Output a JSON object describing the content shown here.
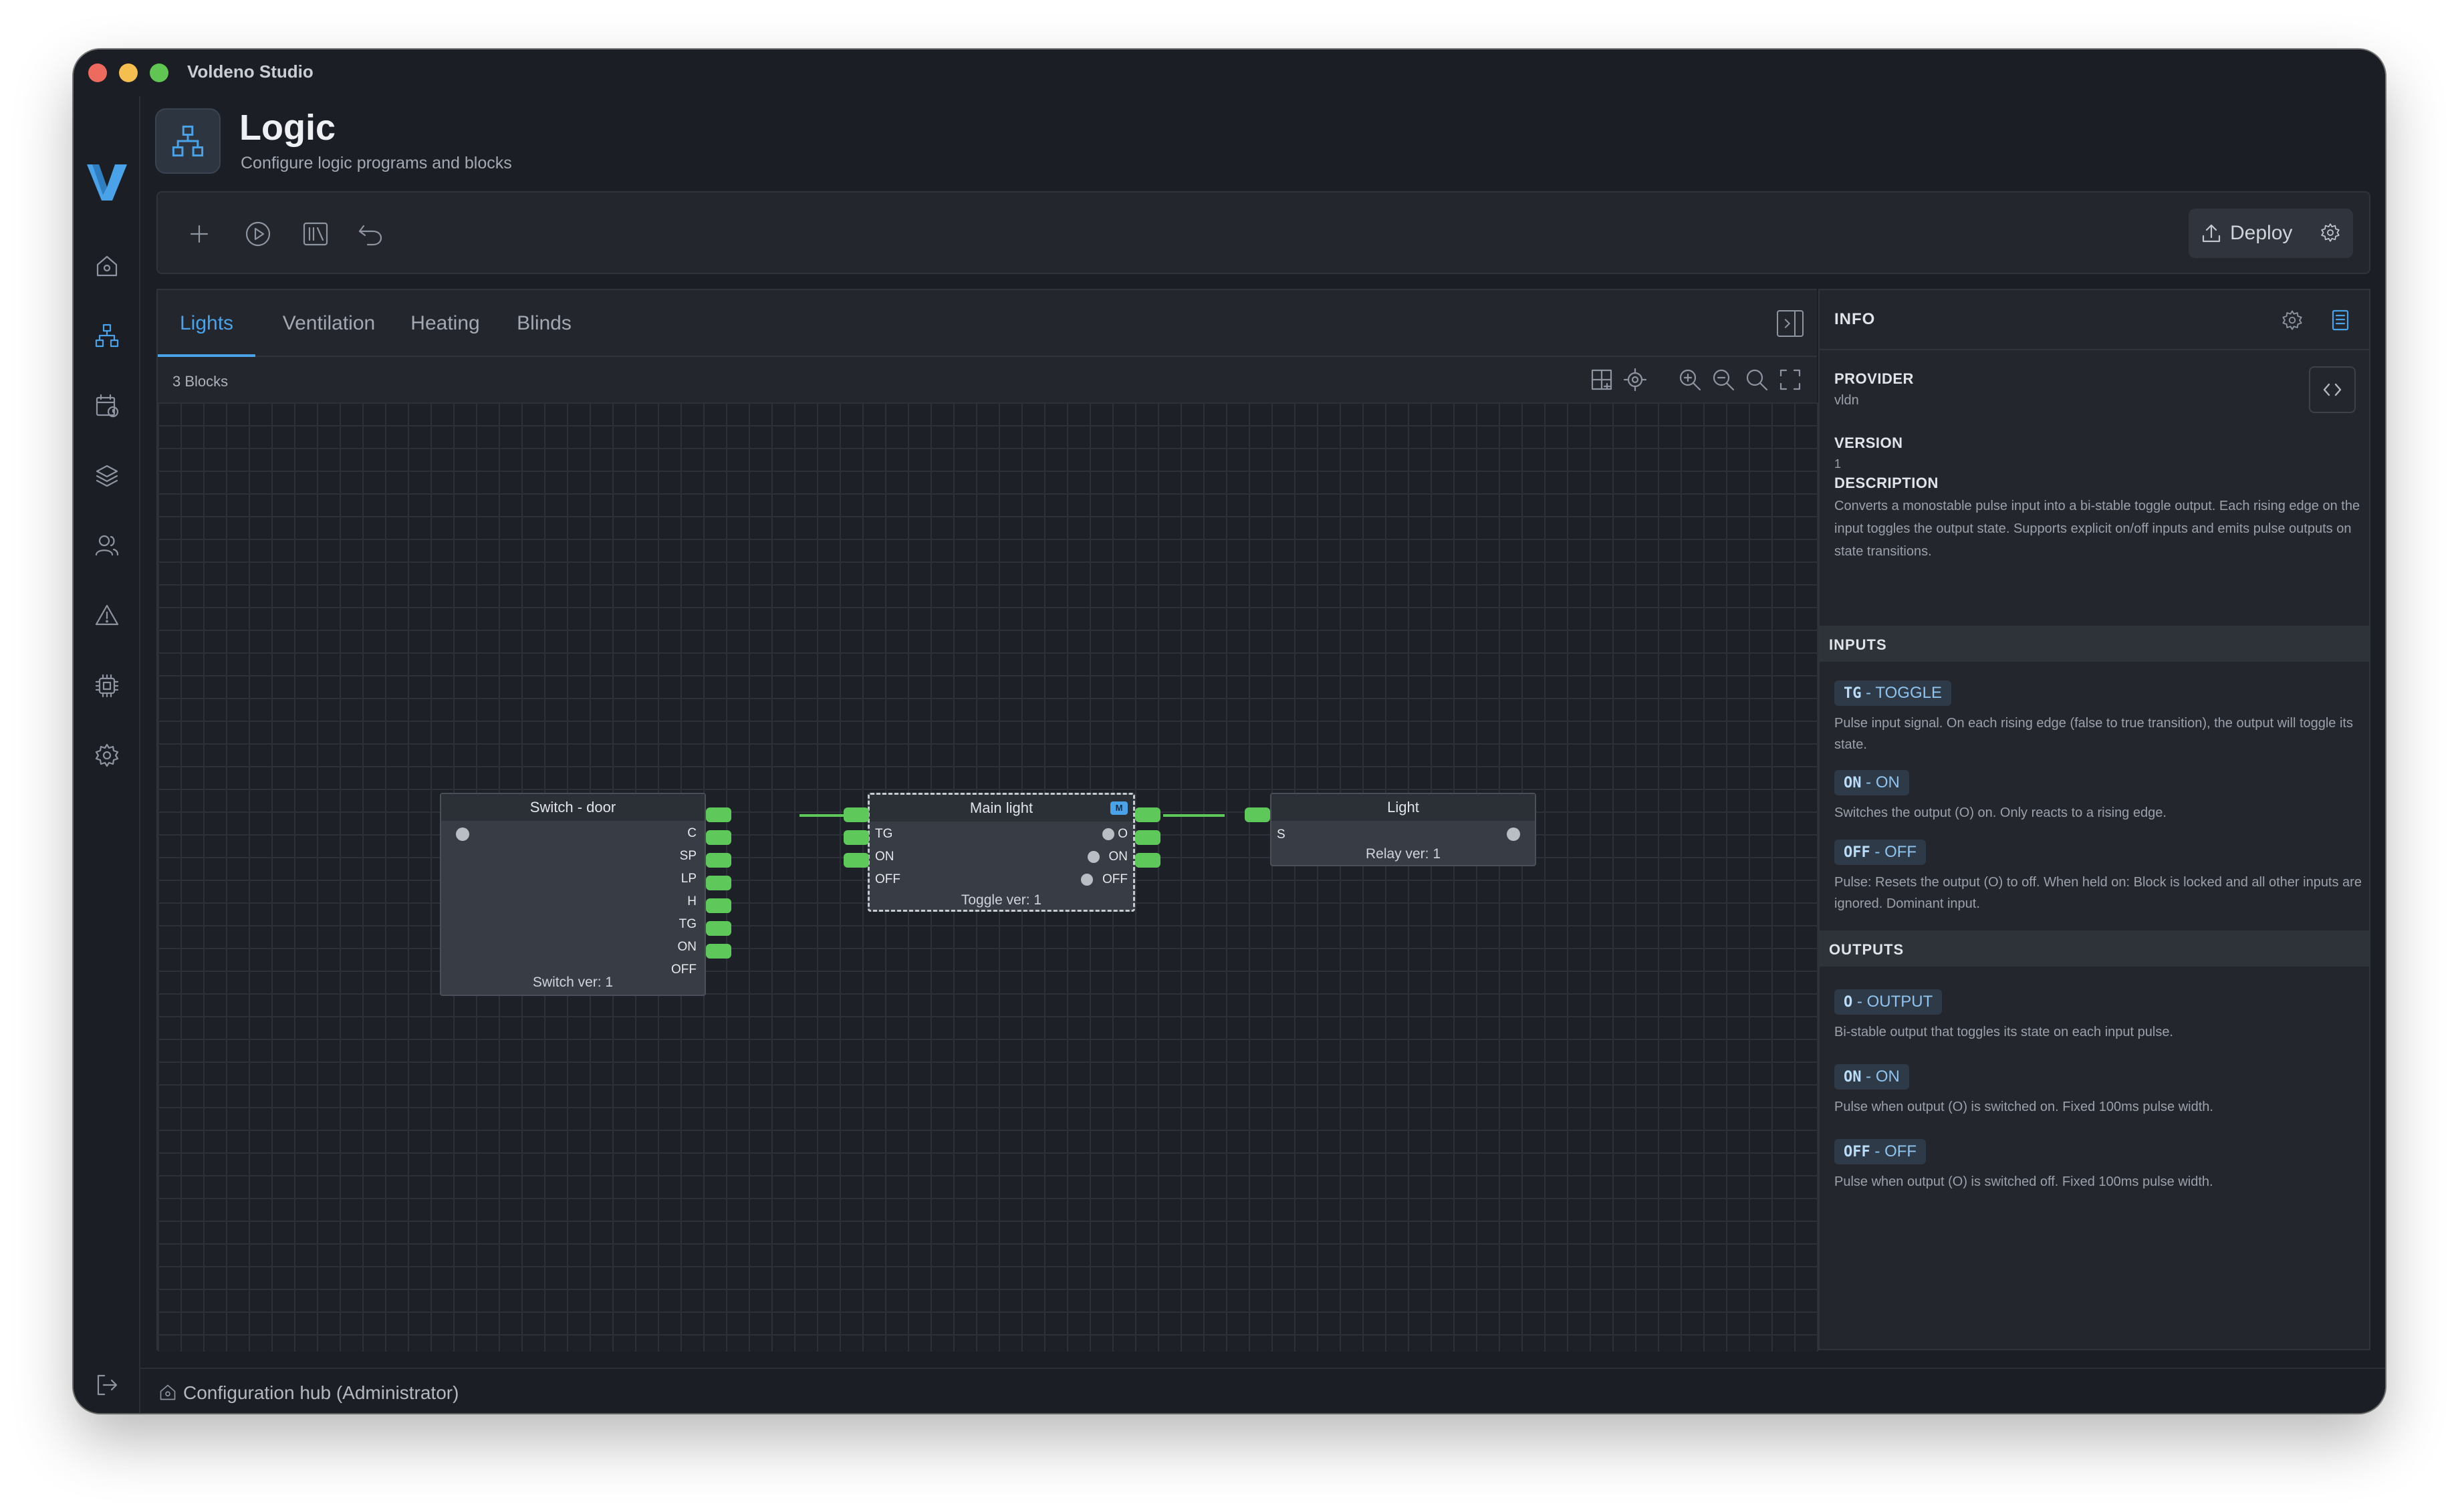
{
  "app": {
    "title": "Voldeno Studio"
  },
  "header": {
    "title": "Logic",
    "subtitle": "Configure logic programs and blocks"
  },
  "nav": [
    "home-icon",
    "logic-icon",
    "schedule-icon",
    "layers-icon",
    "users-icon",
    "alerts-icon",
    "hardware-icon",
    "settings-icon",
    "logout-icon"
  ],
  "toolbar": {
    "deploy_label": "Deploy"
  },
  "tabs": [
    "Lights",
    "Ventilation",
    "Heating",
    "Blinds"
  ],
  "canvas": {
    "blocks_count": "3 Blocks"
  },
  "blocks": {
    "switch": {
      "title": "Switch - door",
      "footer": "Switch ver: 1",
      "outputs": [
        "C",
        "SP",
        "LP",
        "H",
        "TG",
        "ON",
        "OFF"
      ]
    },
    "toggle": {
      "title": "Main light",
      "footer": "Toggle ver: 1",
      "badge": "M",
      "inputs": [
        "TG",
        "ON",
        "OFF"
      ],
      "outputs": [
        "O",
        "ON",
        "OFF"
      ]
    },
    "relay": {
      "title": "Light",
      "footer": "Relay ver: 1",
      "inputs": [
        "S"
      ]
    }
  },
  "info": {
    "title": "INFO",
    "provider_label": "PROVIDER",
    "provider": "vldn",
    "version_label": "VERSION",
    "version": "1",
    "description_label": "DESCRIPTION",
    "description": "Converts a monostable pulse input into a bi-stable toggle output. Each rising edge on the input toggles the output state. Supports explicit on/off inputs and emits pulse outputs on state transitions.",
    "inputs_label": "INPUTS",
    "inputs": [
      {
        "code": "TG",
        "name": " - TOGGLE",
        "desc": "Pulse input signal. On each rising edge (false to true transition), the output will toggle its state."
      },
      {
        "code": "ON",
        "name": " - ON",
        "desc": "Switches the output (O) on. Only reacts to a rising edge."
      },
      {
        "code": "OFF",
        "name": " - OFF",
        "desc": "Pulse: Resets the output (O) to off. When held on: Block is locked and all other inputs are ignored. Dominant input."
      }
    ],
    "outputs_label": "OUTPUTS",
    "outputs": [
      {
        "code": "O",
        "name": " - OUTPUT",
        "desc": "Bi-stable output that toggles its state on each input pulse."
      },
      {
        "code": "ON",
        "name": " - ON",
        "desc": "Pulse when output (O) is switched on. Fixed 100ms pulse width."
      },
      {
        "code": "OFF",
        "name": " - OFF",
        "desc": "Pulse when output (O) is switched off. Fixed 100ms pulse width."
      }
    ]
  },
  "status": {
    "text": "Configuration hub (Administrator)"
  },
  "colors": {
    "accent": "#4aa3e8",
    "pin": "#5ec95a",
    "background": "#1b1e24"
  }
}
